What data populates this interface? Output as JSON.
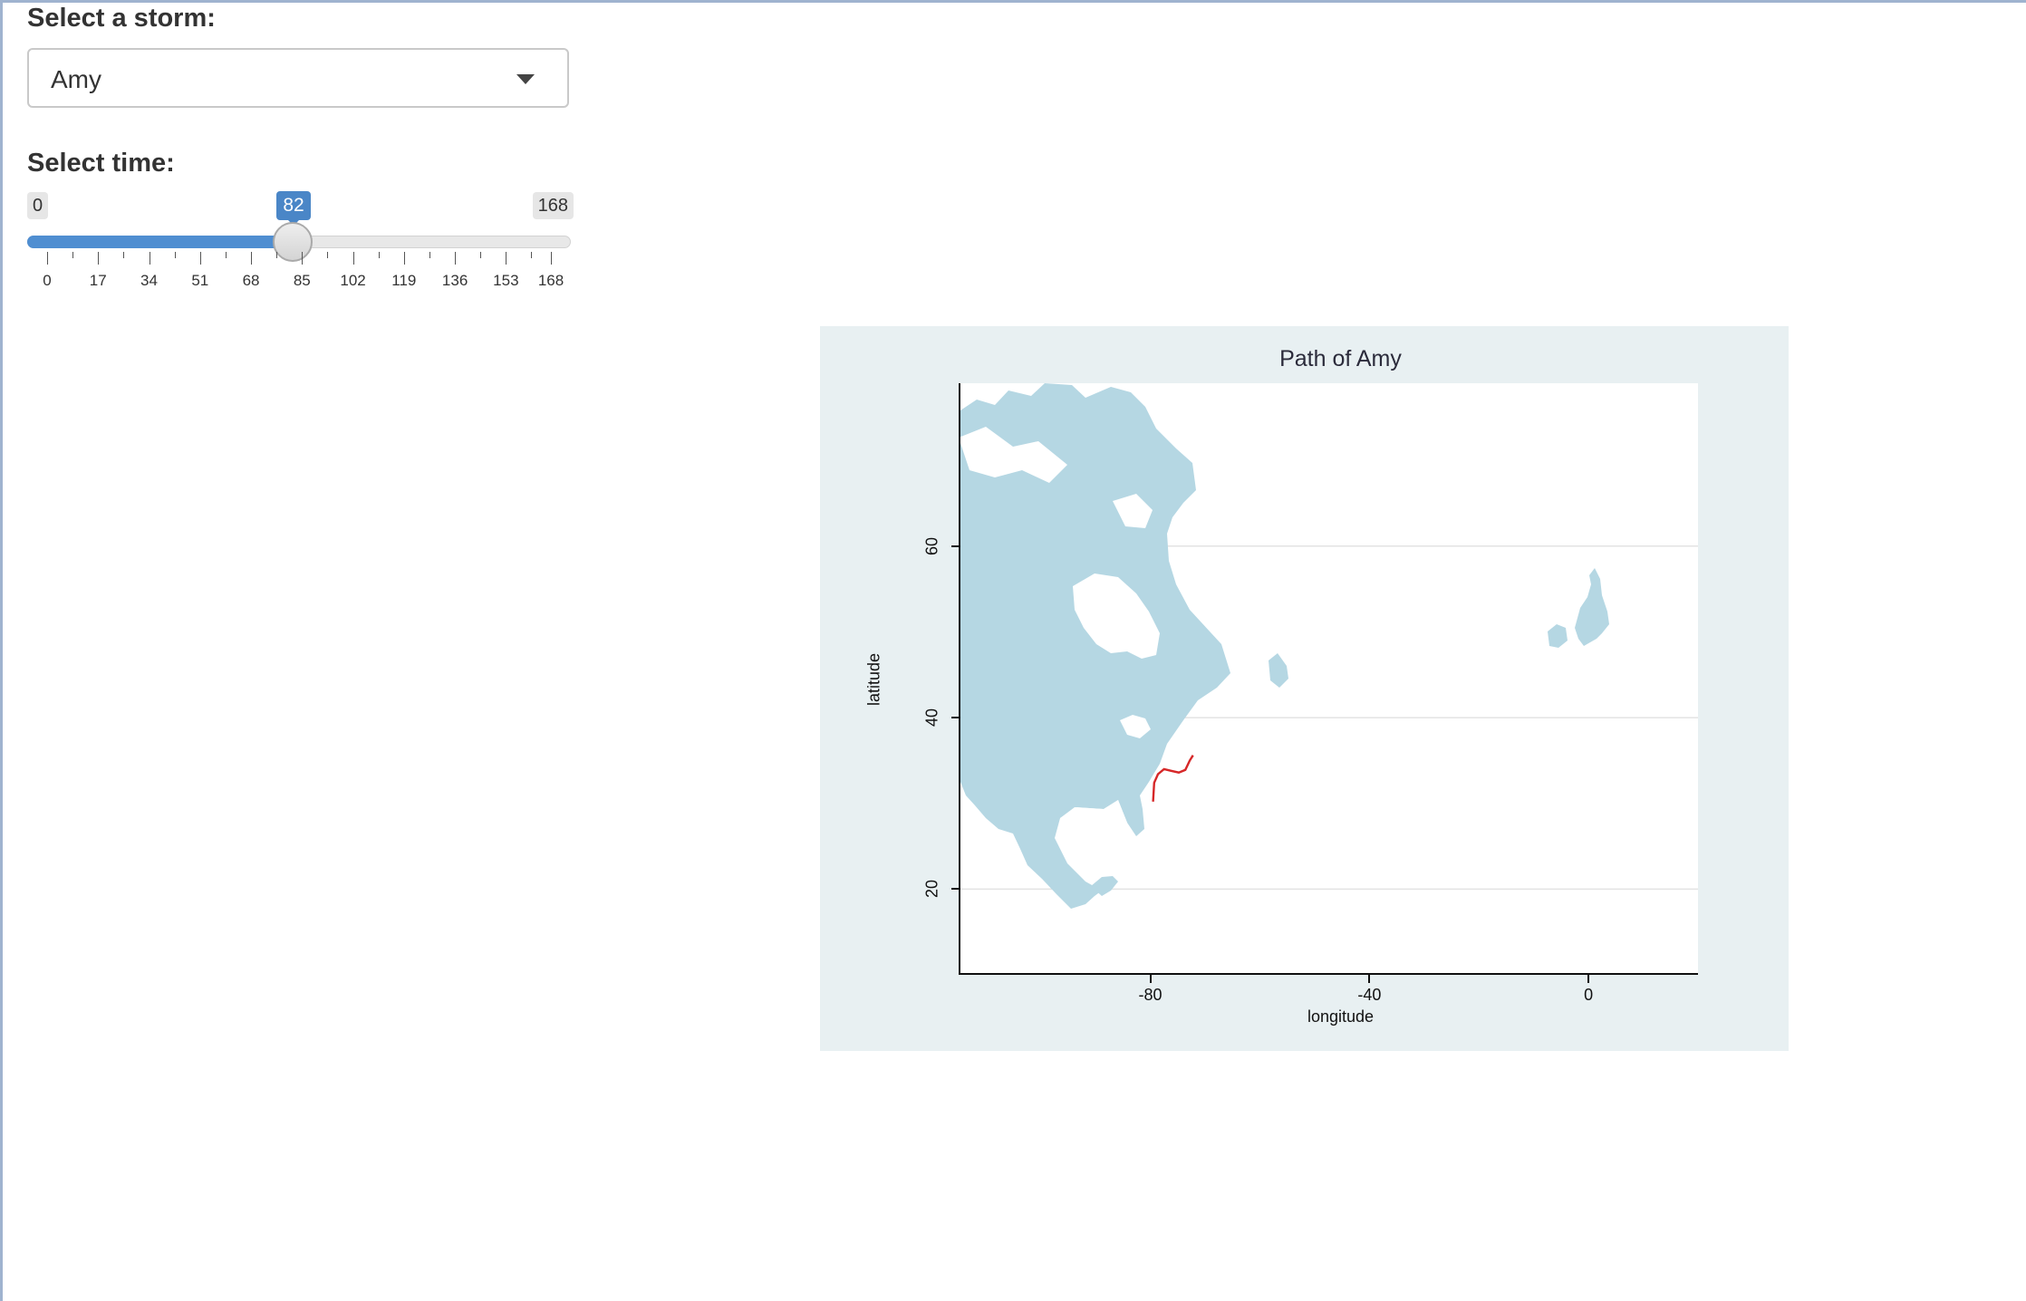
{
  "storm_select": {
    "label": "Select a storm:",
    "value": "Amy"
  },
  "time_slider": {
    "label": "Select time:",
    "min_label": "0",
    "max_label": "168",
    "value_label": "82",
    "min": 0,
    "max": 168,
    "value": 82,
    "tick_labels": [
      "0",
      "17",
      "34",
      "51",
      "68",
      "85",
      "102",
      "119",
      "136",
      "153",
      "168"
    ]
  },
  "colors": {
    "accent": "#4f8ed1",
    "land": "#b5d7e3",
    "track": "#d62728",
    "panel_bg": "#e8f0f2"
  },
  "chart_data": {
    "type": "line",
    "title": "Path of Amy",
    "xlabel": "longitude",
    "ylabel": "latitude",
    "xlim": [
      -115,
      20
    ],
    "ylim": [
      10,
      79
    ],
    "x_ticks": [
      "-80",
      "-40",
      "0"
    ],
    "y_ticks": [
      "20",
      "40",
      "60"
    ],
    "series": [
      {
        "points": [
          [
            -79.5,
            30.2
          ],
          [
            -79.3,
            32.4
          ],
          [
            -78.6,
            33.4
          ],
          [
            -77.5,
            34.0
          ],
          [
            -76.2,
            33.8
          ],
          [
            -74.8,
            33.6
          ],
          [
            -73.6,
            33.9
          ],
          [
            -72.8,
            35.0
          ],
          [
            -72.2,
            35.6
          ]
        ]
      }
    ],
    "grid": true
  }
}
